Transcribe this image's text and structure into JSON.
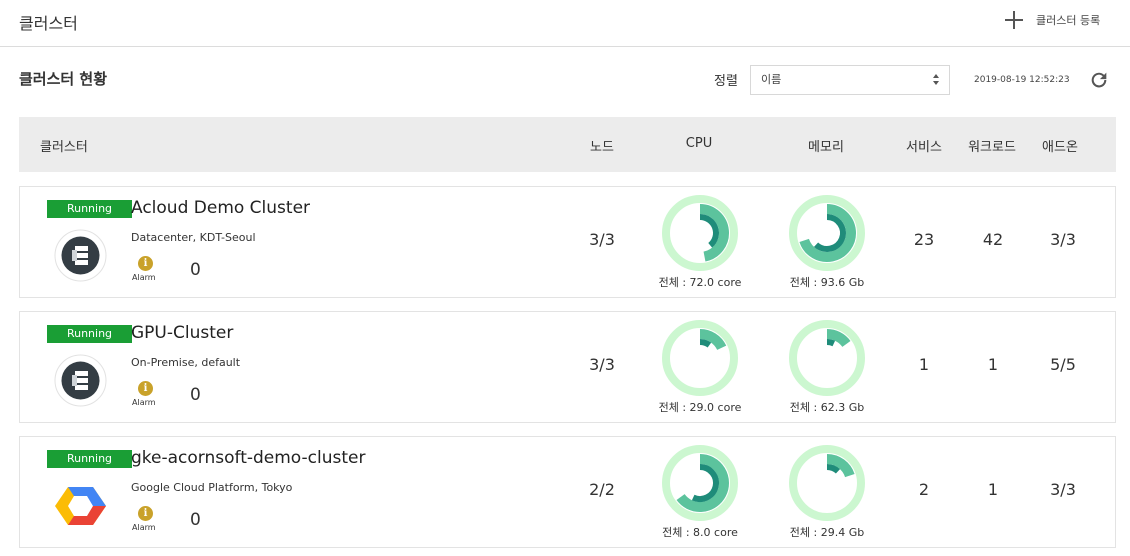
{
  "header": {
    "title": "클러스터",
    "register_label": "클러스터 등록"
  },
  "subheader": {
    "title": "클러스터 현황",
    "sort_label": "정렬",
    "sort_value": "이름",
    "timestamp": "2019-08-19 12:52:23"
  },
  "table": {
    "columns": [
      "클러스터",
      "노드",
      "CPU",
      "메모리",
      "서비스",
      "워크로드",
      "애드온"
    ]
  },
  "clusters": [
    {
      "status": "Running",
      "name": "Acloud Demo Cluster",
      "location": "Datacenter, KDT-Seoul",
      "logo": "server-stack-icon",
      "alarm_label": "Alarm",
      "alarm_count": "0",
      "nodes": "3/3",
      "cpu_usage_fraction": 0.47,
      "cpu_total": "전체 : 72.0 core",
      "mem_usage_fraction": 0.7,
      "mem_total": "전체 : 93.6 Gb",
      "services": "23",
      "workloads": "42",
      "addons": "3/3"
    },
    {
      "status": "Running",
      "name": "GPU-Cluster",
      "location": "On-Premise, default",
      "logo": "server-stack-icon",
      "alarm_label": "Alarm",
      "alarm_count": "0",
      "nodes": "3/3",
      "cpu_usage_fraction": 0.18,
      "cpu_total": "전체 : 29.0 core",
      "mem_usage_fraction": 0.15,
      "mem_total": "전체 : 62.3 Gb",
      "services": "1",
      "workloads": "1",
      "addons": "5/5"
    },
    {
      "status": "Running",
      "name": "gke-acornsoft-demo-cluster",
      "location": "Google Cloud Platform, Tokyo",
      "logo": "google-cloud-icon",
      "alarm_label": "Alarm",
      "alarm_count": "0",
      "nodes": "2/2",
      "cpu_usage_fraction": 0.65,
      "cpu_total": "전체 : 8.0 core",
      "mem_usage_fraction": 0.2,
      "mem_total": "전체 : 29.4 Gb",
      "services": "2",
      "workloads": "1",
      "addons": "3/3"
    }
  ],
  "colors": {
    "running": "#1a9e35",
    "donut_track": "#ccf7d0",
    "donut_outer": "#5cc39d",
    "donut_inner": "#1f8c7a",
    "alarm": "#c9a22a",
    "table_header": "#ececec"
  }
}
